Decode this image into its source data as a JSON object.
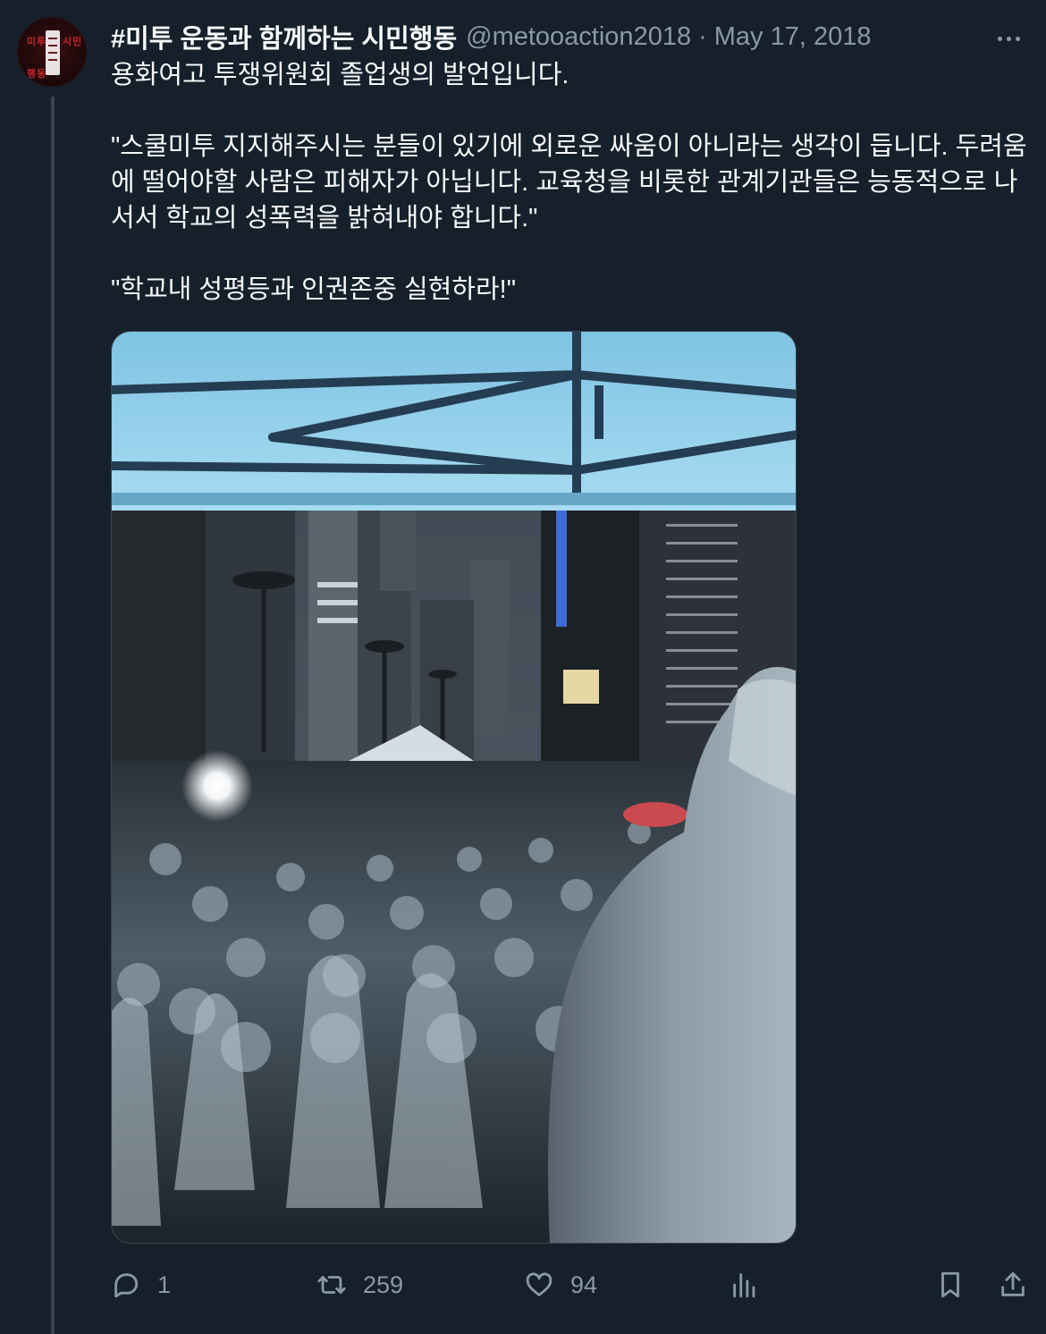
{
  "tweet": {
    "author": {
      "name": "#미투 운동과 함께하는 시민행동",
      "handle": "@metooaction2018",
      "avatar_text": [
        "미투",
        "시민",
        "행동"
      ]
    },
    "separator": "·",
    "date": "May 17, 2018",
    "paragraphs": [
      "용화여고 투쟁위원회 졸업생의 발언입니다.",
      "\"스쿨미투 지지해주시는 분들이 있기에 외로운 싸움이 아니라는 생각이 듭니다. 두려움에 떨어야할 사람은 피해자가 아닙니다. 교육청을 비롯한 관계기관들은 능동적으로 나서서 학교의 성폭력을 밝혀내야 합니다.\"",
      "\"학교내 성평등과 인권존중 실현하라!\""
    ],
    "media": {
      "icon": "photo-rally-crowd-in-rain"
    },
    "actions": {
      "replies": "1",
      "retweets": "259",
      "likes": "94"
    }
  },
  "colors": {
    "background": "#15202b",
    "text": "#f7f9f9",
    "muted": "#8b98a5",
    "border": "#38444d"
  }
}
